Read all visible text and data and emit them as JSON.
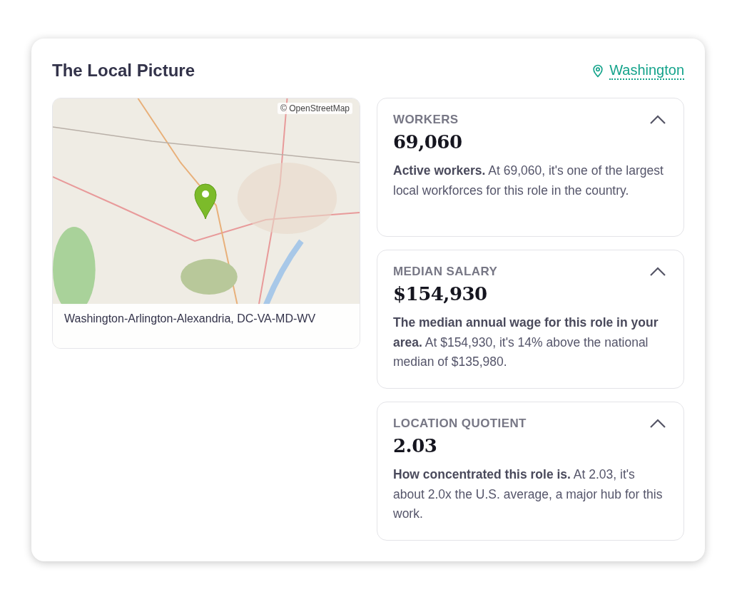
{
  "title": "The Local Picture",
  "location_link": "Washington",
  "map": {
    "attribution": "© OpenStreetMap",
    "caption": "Washington-Arlington-Alexandria, DC-VA-MD-WV"
  },
  "stats": [
    {
      "label": "WORKERS",
      "value": "69,060",
      "description": "**Active workers.** At 69,060, it's one of the largest local workforces for this role in the country.",
      "expanded": true
    },
    {
      "label": "MEDIAN SALARY",
      "value": "$154,930",
      "description": "**The median annual wage for this role in your area.** At $154,930, it's 14% above the national median of $135,980.",
      "expanded": true
    },
    {
      "label": "LOCATION QUOTIENT",
      "value": "2.03",
      "description": "**How concentrated this role is.** At 2.03, it's about 2.0x the U.S. average, a major hub for this work.",
      "expanded": true
    }
  ]
}
